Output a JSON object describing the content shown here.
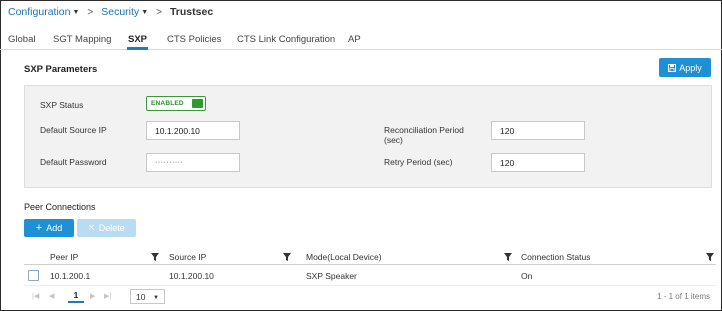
{
  "breadcrumb": {
    "items": [
      {
        "label": "Configuration"
      },
      {
        "label": "Security"
      }
    ],
    "current": "Trustsec"
  },
  "tabs": [
    {
      "label": "Global"
    },
    {
      "label": "SGT Mapping"
    },
    {
      "label": "SXP",
      "active": true
    },
    {
      "label": "CTS Policies"
    },
    {
      "label": "CTS Link Configuration"
    },
    {
      "label": "AP"
    }
  ],
  "sxp": {
    "title": "SXP Parameters",
    "apply_label": "Apply",
    "status_label": "SXP Status",
    "status_value": "ENABLED",
    "default_source_ip_label": "Default Source IP",
    "default_source_ip_value": "10.1.200.10",
    "default_password_label": "Default Password",
    "default_password_value": "··········",
    "reconciliation_label_line1": "Reconciliation Period",
    "reconciliation_label_line2": "(sec)",
    "reconciliation_value": "120",
    "retry_label": "Retry Period (sec)",
    "retry_value": "120"
  },
  "peers": {
    "title": "Peer Connections",
    "add_label": "Add",
    "delete_label": "Delete",
    "columns": [
      "Peer IP",
      "Source IP",
      "Mode(Local Device)",
      "Connection Status"
    ],
    "rows": [
      {
        "peer_ip": "10.1.200.1",
        "source_ip": "10.1.200.10",
        "mode": "SXP Speaker",
        "status": "On"
      }
    ],
    "pager": {
      "page": "1",
      "page_size": "10",
      "info": "1 - 1 of 1 items"
    }
  },
  "colors": {
    "accent": "#1e90d6",
    "enabled_green": "#2e9b2e",
    "link": "#1a73b5"
  }
}
